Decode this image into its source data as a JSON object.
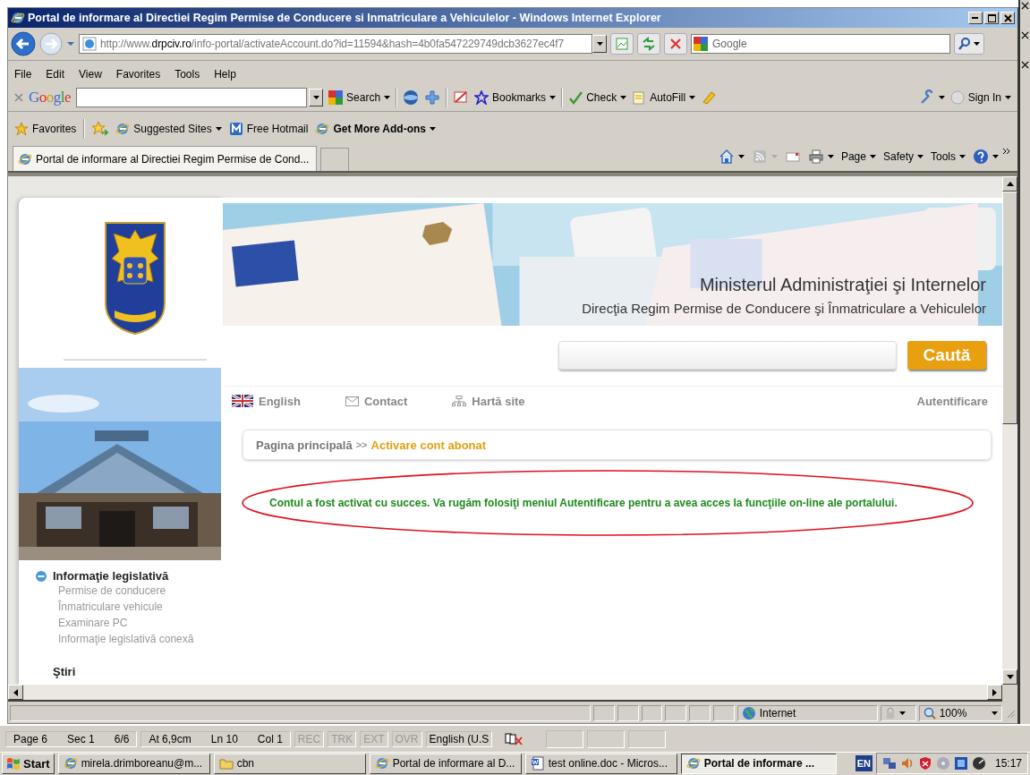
{
  "window": {
    "title": "Portal de informare al Directiei Regim Permise de Conducere si Inmatriculare a Vehiculelor - Windows Internet Explorer"
  },
  "address_bar": {
    "url_prefix": "http://www.",
    "url_domain": "drpciv.ro",
    "url_path": "/info-portal/activateAccount.do?id=11594&hash=4b0fa547229749dcb3627ec4f7"
  },
  "search_box": {
    "placeholder": "Google"
  },
  "menu": [
    "File",
    "Edit",
    "View",
    "Favorites",
    "Tools",
    "Help"
  ],
  "google_toolbar": {
    "logo": "Google",
    "search": "Search",
    "bookmarks": "Bookmarks",
    "check": "Check",
    "autofill": "AutoFill",
    "sign_in": "Sign In"
  },
  "favorites_bar": {
    "favorites": "Favorites",
    "links": [
      {
        "label": "Suggested Sites",
        "kind": "ie",
        "dropdown": true,
        "emphasized": false
      },
      {
        "label": "Free Hotmail",
        "kind": "hotmail",
        "dropdown": false,
        "emphasized": false
      },
      {
        "label": "Get More Add-ons",
        "kind": "ie",
        "dropdown": true,
        "emphasized": true
      }
    ]
  },
  "tabs": [
    {
      "title": "Portal de informare al Directiei Regim Permise de Cond...",
      "selected": true
    }
  ],
  "command_bar": [
    "Page",
    "Safety",
    "Tools"
  ],
  "page": {
    "sidebar": {
      "section": {
        "title": "Informaţie legislativă",
        "expanded": true,
        "items": [
          "Permise de conducere",
          "Înmatriculare vehicule",
          "Examinare PC",
          "Informaţie legislativă conexă"
        ]
      },
      "next_section": "Ştiri"
    },
    "header": {
      "title": "Ministerul Administraţiei şi Internelor",
      "subtitle": "Direcţia Regim Permise de Conducere şi Înmatriculare a Vehiculelor"
    },
    "search": {
      "button": "Caută"
    },
    "nav": [
      {
        "label": "English",
        "kind": "flag"
      },
      {
        "label": "Contact",
        "kind": "mail"
      },
      {
        "label": "Hartă site",
        "kind": "sitemap"
      }
    ],
    "login": "Autentificare",
    "breadcrumb": {
      "home": "Pagina principală",
      "separator": ">>",
      "current": "Activare cont abonat"
    },
    "message": "Contul a fost activat cu succes. Va rugăm folosiţi meniul Autentificare pentru a avea acces la funcţiile on-line ale portalului."
  },
  "ie_status": {
    "zone": "Internet",
    "zoom": "100%"
  },
  "word_status": {
    "fields": [
      "Page 6",
      "Sec 1",
      "6/6",
      "At 6,9cm",
      "Ln 10",
      "Col 1"
    ],
    "modes": [
      {
        "label": "REC",
        "active": false
      },
      {
        "label": "TRK",
        "active": false
      },
      {
        "label": "EXT",
        "active": false
      },
      {
        "label": "OVR",
        "active": false
      }
    ],
    "language": "English (U.S"
  },
  "taskbar": {
    "start": "Start",
    "items": [
      {
        "label": "mirela.drimboreanu@m...",
        "kind": "ie",
        "selected": false
      },
      {
        "label": "cbn",
        "kind": "folder",
        "selected": false
      },
      {
        "label": "Portal de informare al D...",
        "kind": "ie",
        "selected": false
      },
      {
        "label": "test online.doc - Micros...",
        "kind": "word",
        "selected": false
      },
      {
        "label": "Portal de informare ...",
        "kind": "ie",
        "selected": true
      }
    ],
    "language": "EN",
    "clock": "15:17"
  }
}
